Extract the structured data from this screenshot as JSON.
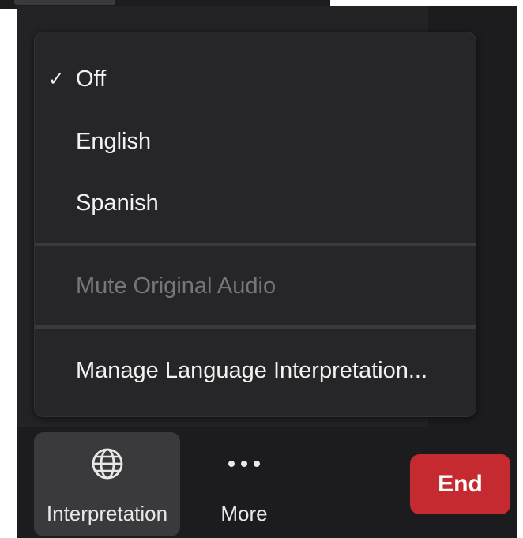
{
  "menu": {
    "items": [
      {
        "label": "Off",
        "checked": true,
        "disabled": false
      },
      {
        "label": "English",
        "checked": false,
        "disabled": false
      },
      {
        "label": "Spanish",
        "checked": false,
        "disabled": false
      }
    ],
    "check_glyph": "✓",
    "mute_label": "Mute Original Audio",
    "manage_label": "Manage Language Interpretation..."
  },
  "toolbar": {
    "interpretation_label": "Interpretation",
    "interpretation_icon": "globe-icon",
    "more_label": "More",
    "more_icon": "ellipsis-icon",
    "end_label": "End"
  },
  "colors": {
    "end_button": "#c42a2f",
    "menu_background": "#262628",
    "meeting_background": "#1c1c1e"
  }
}
